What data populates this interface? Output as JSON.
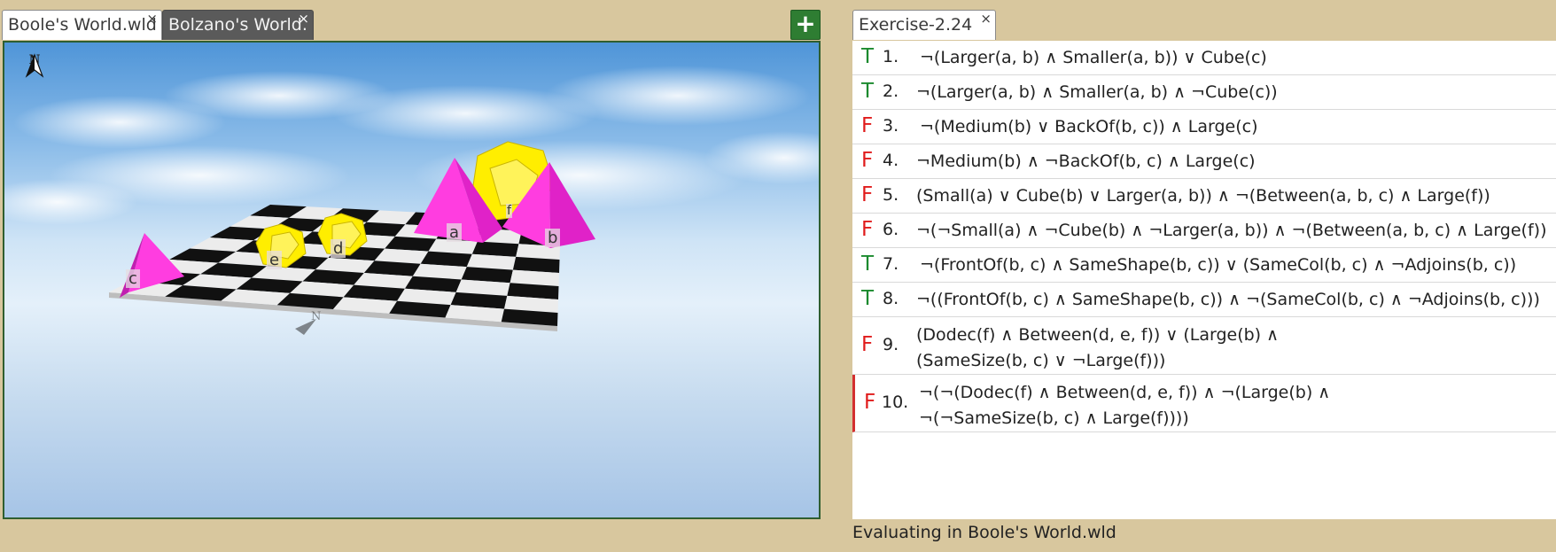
{
  "left_tabs": [
    {
      "label": "Boole's World.wld",
      "close": "×",
      "active": true
    },
    {
      "label": "Bolzano's World.",
      "close": "×",
      "active": false
    }
  ],
  "add_button": "+",
  "compass": {
    "north": "N"
  },
  "world_labels": {
    "a": "a",
    "b": "b",
    "c": "c",
    "d": "d",
    "e": "e",
    "f": "f"
  },
  "exercise_tab": {
    "label": "Exercise-2.24",
    "close": "×"
  },
  "sentences": [
    {
      "truth": "T",
      "num": "1.",
      "lines": [
        "¬(Larger(a, b) ∧ Smaller(a, b)) ∨ Cube(c)"
      ]
    },
    {
      "truth": "T",
      "num": "2.",
      "lines": [
        "¬(Larger(a, b) ∧ Smaller(a, b) ∧ ¬Cube(c))"
      ]
    },
    {
      "truth": "F",
      "num": "3.",
      "lines": [
        "¬(Medium(b) ∨ BackOf(b, c)) ∧ Large(c)"
      ]
    },
    {
      "truth": "F",
      "num": "4.",
      "lines": [
        "¬Medium(b) ∧ ¬BackOf(b, c) ∧ Large(c)"
      ]
    },
    {
      "truth": "F",
      "num": "5.",
      "lines": [
        "(Small(a) ∨ Cube(b) ∨ Larger(a, b)) ∧ ¬(Between(a, b, c) ∧ Large(f))"
      ]
    },
    {
      "truth": "F",
      "num": "6.",
      "lines": [
        "¬(¬Small(a) ∧ ¬Cube(b) ∧ ¬Larger(a, b)) ∧ ¬(Between(a, b, c) ∧ Large(f))"
      ]
    },
    {
      "truth": "T",
      "num": "7.",
      "lines": [
        "¬(FrontOf(b, c) ∧ SameShape(b, c)) ∨ (SameCol(b, c) ∧ ¬Adjoins(b, c))"
      ]
    },
    {
      "truth": "T",
      "num": "8.",
      "lines": [
        "¬((FrontOf(b, c) ∧ SameShape(b, c)) ∧ ¬(SameCol(b, c) ∧ ¬Adjoins(b, c)))"
      ]
    },
    {
      "truth": "F",
      "num": "9.",
      "lines": [
        "(Dodec(f) ∧ Between(d, e, f)) ∨ (Large(b) ∧",
        "(SameSize(b, c) ∨ ¬Large(f)))"
      ]
    },
    {
      "truth": "F",
      "num": "10.",
      "lines": [
        "¬(¬(Dodec(f) ∧ Between(d, e, f)) ∧ ¬(Large(b) ∧",
        "¬(¬SameSize(b, c) ∧ Large(f))))"
      ],
      "selected": true
    }
  ],
  "status_text": "Evaluating in Boole's World.wld",
  "colors": {
    "background": "#d8c79e",
    "true": "#1b8a2e",
    "false": "#e01b1b",
    "accent": "#2e7d32",
    "pyramid": "#ff3de0",
    "dodec": "#ffee00"
  }
}
